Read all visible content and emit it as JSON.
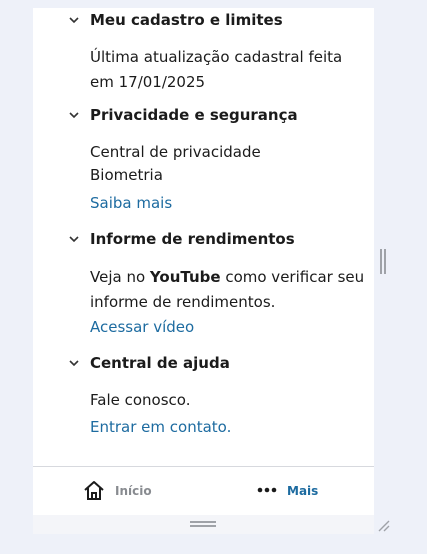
{
  "sections": [
    {
      "title": "Meu cadastro e limites",
      "lines": [
        "Última atualização cadastral feita",
        "em 17/01/2025"
      ]
    },
    {
      "title": "Privacidade e segurança",
      "lines": [
        "Central de privacidade",
        "Biometria"
      ],
      "link": "Saiba mais"
    },
    {
      "title": "Informe de rendimentos",
      "lines_rich": {
        "prefix": "Veja no ",
        "bold": "YouTube",
        "suffix": " como verificar seu",
        "line2": "informe de rendimentos."
      },
      "link": "Acessar vídeo"
    },
    {
      "title": "Central de ajuda",
      "lines": [
        "Fale conosco."
      ],
      "link": "Entrar em contato."
    }
  ],
  "bottom_nav": {
    "home_label": "Início",
    "home_icon": "home-icon",
    "more_label": "Mais",
    "more_icon": "more-dots-icon"
  },
  "colors": {
    "link": "#1d6ba0",
    "inactive_nav": "#888b90",
    "background": "#eef1f9"
  }
}
